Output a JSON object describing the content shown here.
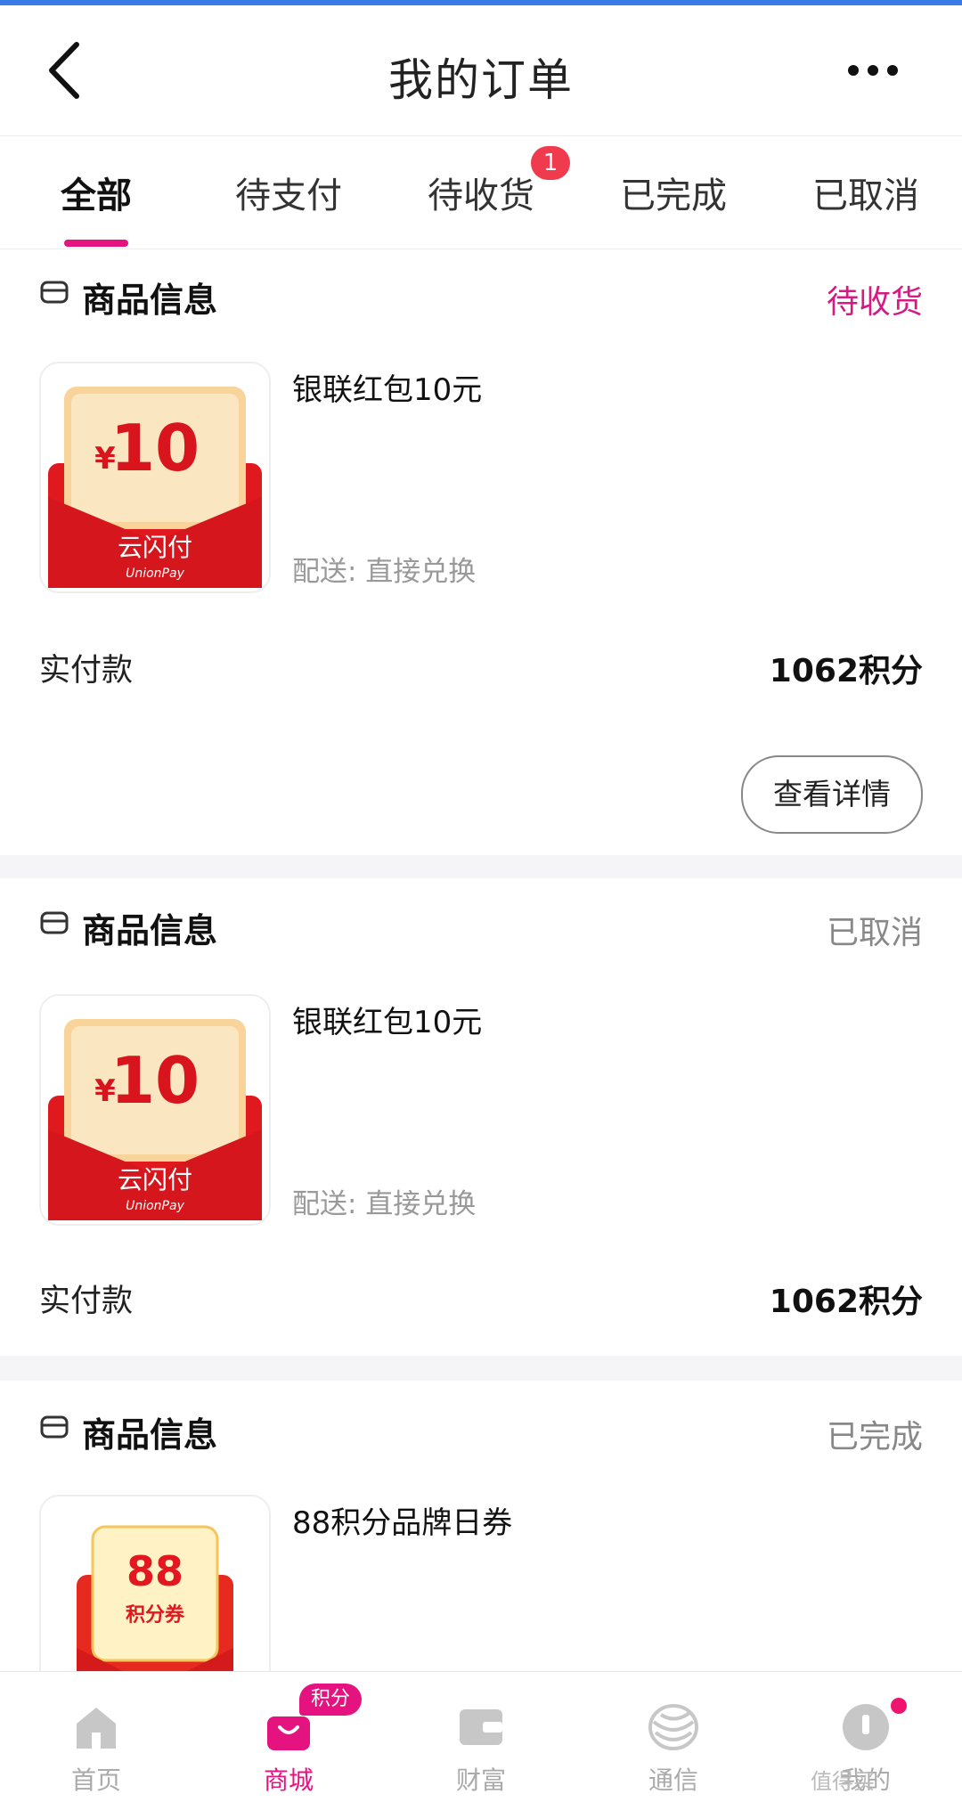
{
  "header": {
    "title": "我的订单"
  },
  "tabs": [
    {
      "label": "全部",
      "active": true
    },
    {
      "label": "待支付",
      "active": false
    },
    {
      "label": "待收货",
      "active": false,
      "badge": "1"
    },
    {
      "label": "已完成",
      "active": false
    },
    {
      "label": "已取消",
      "active": false
    }
  ],
  "orders": [
    {
      "section_label": "商品信息",
      "status": "待收货",
      "status_color": "#d61a83",
      "product_name": "银联红包10元",
      "thumb": {
        "amount": "10",
        "currency": "¥",
        "brand": "云闪付",
        "brand_en": "UnionPay"
      },
      "delivery": "配送: 直接兑换",
      "paid_label": "实付款",
      "paid_value": "1062积分",
      "detail_button": "查看详情"
    },
    {
      "section_label": "商品信息",
      "status": "已取消",
      "status_color": "#888888",
      "product_name": "银联红包10元",
      "thumb": {
        "amount": "10",
        "currency": "¥",
        "brand": "云闪付",
        "brand_en": "UnionPay"
      },
      "delivery": "配送: 直接兑换",
      "paid_label": "实付款",
      "paid_value": "1062积分"
    },
    {
      "section_label": "商品信息",
      "status": "已完成",
      "status_color": "#888888",
      "product_name": "88积分品牌日券",
      "thumb": {
        "amount": "88",
        "subtitle": "积分券"
      }
    }
  ],
  "bottom_nav": [
    {
      "label": "首页",
      "icon": "home-icon",
      "active": false
    },
    {
      "label": "商城",
      "icon": "mall-bag-icon",
      "active": true,
      "pill": "积分"
    },
    {
      "label": "财富",
      "icon": "wallet-icon",
      "active": false
    },
    {
      "label": "通信",
      "icon": "china-mobile-icon",
      "active": false
    },
    {
      "label": "我的",
      "icon": "profile-icon",
      "active": false
    }
  ],
  "watermark": "值得买",
  "colors": {
    "accent": "#e5137f",
    "top_bar": "#3b7be8"
  }
}
